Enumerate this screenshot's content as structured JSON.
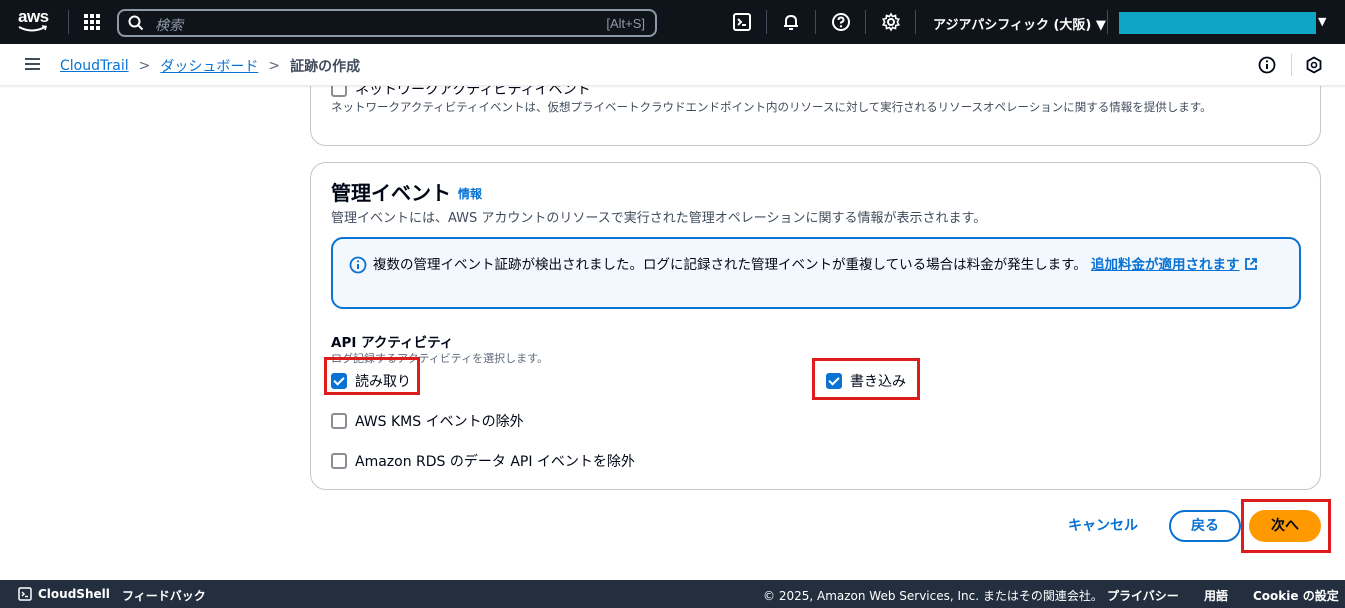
{
  "topnav": {
    "logo_text": "aws",
    "search_placeholder": "検索",
    "search_shortcut": "[Alt+S]",
    "region": "アジアパシフィック (大阪) ▼",
    "account_caret": "▼",
    "account_color": "#0ea5c6"
  },
  "breadcrumb": {
    "items": [
      "CloudTrail",
      "ダッシュボード"
    ],
    "current": "証跡の作成"
  },
  "network_events": {
    "label": "ネットワークアクティビティイベント",
    "description": "ネットワークアクティビティイベントは、仮想プライベートクラウドエンドポイント内のリソースに対して実行されるリソースオペレーションに関する情報を提供します。"
  },
  "management_events": {
    "title": "管理イベント",
    "info": "情報",
    "description": "管理イベントには、AWS アカウントのリソースで実行された管理オペレーションに関する情報が表示されます。",
    "alert_text": "複数の管理イベント証跡が検出されました。ログに記録された管理イベントが重複している場合は料金が発生します。",
    "alert_link": "追加料金が適用されます",
    "api_activity_title": "API アクティビティ",
    "api_activity_subtitle": "ログ記録するアクティビティを選択します。",
    "checkboxes": {
      "read": {
        "label": "読み取り",
        "checked": true
      },
      "write": {
        "label": "書き込み",
        "checked": true
      },
      "exclude_kms": {
        "label": "AWS KMS イベントの除外",
        "checked": false
      },
      "exclude_rds": {
        "label": "Amazon RDS のデータ API イベントを除外",
        "checked": false
      }
    }
  },
  "buttons": {
    "cancel": "キャンセル",
    "back": "戻る",
    "next": "次へ"
  },
  "footer": {
    "cloudshell": "CloudShell",
    "feedback": "フィードバック",
    "copyright": "© 2025, Amazon Web Services, Inc. またはその関連会社。",
    "privacy": "プライバシー",
    "terms": "用語",
    "cookie": "Cookie の設定"
  },
  "highlight_color": "#dd1c1c",
  "accent_color": "#0972d3",
  "primary_button_color": "#ff9900"
}
